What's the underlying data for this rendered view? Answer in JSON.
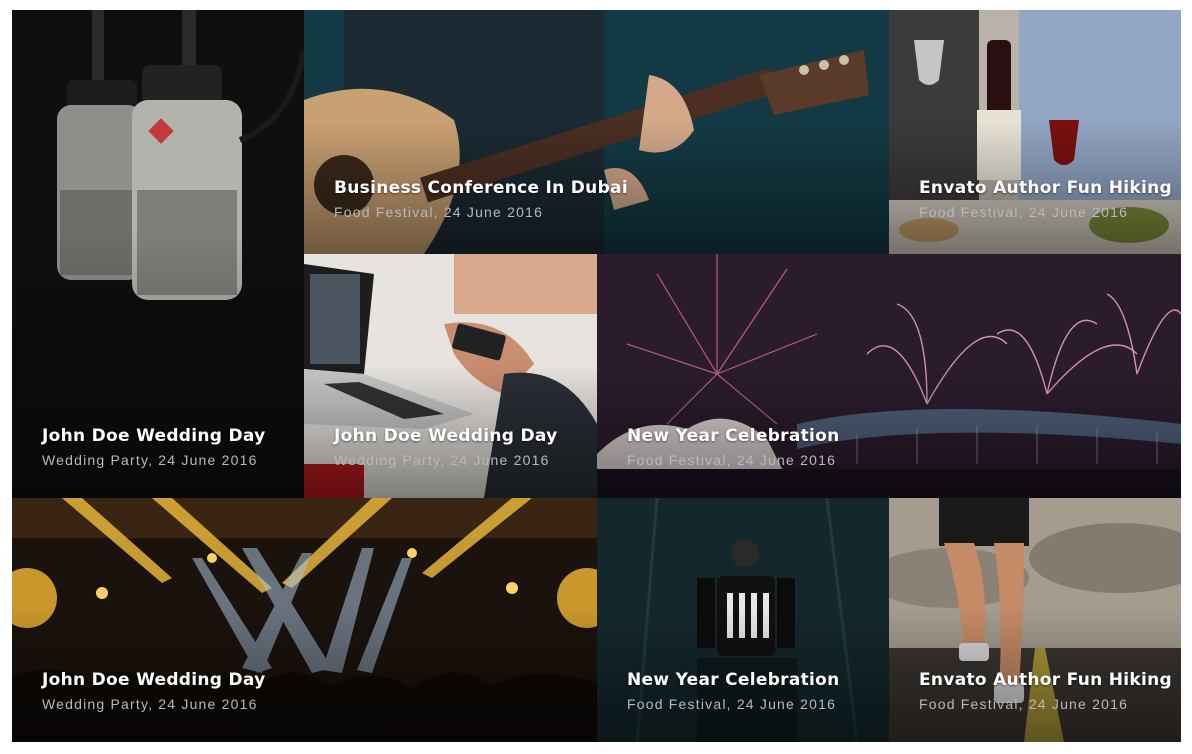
{
  "gallery": {
    "items": [
      {
        "title": "John Doe Wedding Day",
        "meta": "Wedding Party, 24 June 2016",
        "image": "studio-microphones"
      },
      {
        "title": "Business Conference In Dubai",
        "meta": "Food Festival, 24 June 2016",
        "image": "acoustic-guitar"
      },
      {
        "title": "Envato Author Fun Hiking",
        "meta": "Food Festival, 24 June 2016",
        "image": "wine-dinner"
      },
      {
        "title": "John Doe Wedding Day",
        "meta": "Wedding Party, 24 June 2016",
        "image": "laptop-meeting"
      },
      {
        "title": "New Year Celebration",
        "meta": "Food Festival, 24 June 2016",
        "image": "harbour-fireworks"
      },
      {
        "title": "John Doe Wedding Day",
        "meta": "Wedding Party, 24 June 2016",
        "image": "concert-crowd"
      },
      {
        "title": "New Year Celebration",
        "meta": "Food Festival, 24 June 2016",
        "image": "dj-performer"
      },
      {
        "title": "Envato Author Fun Hiking",
        "meta": "Food Festival, 24 June 2016",
        "image": "runner-road"
      }
    ]
  }
}
